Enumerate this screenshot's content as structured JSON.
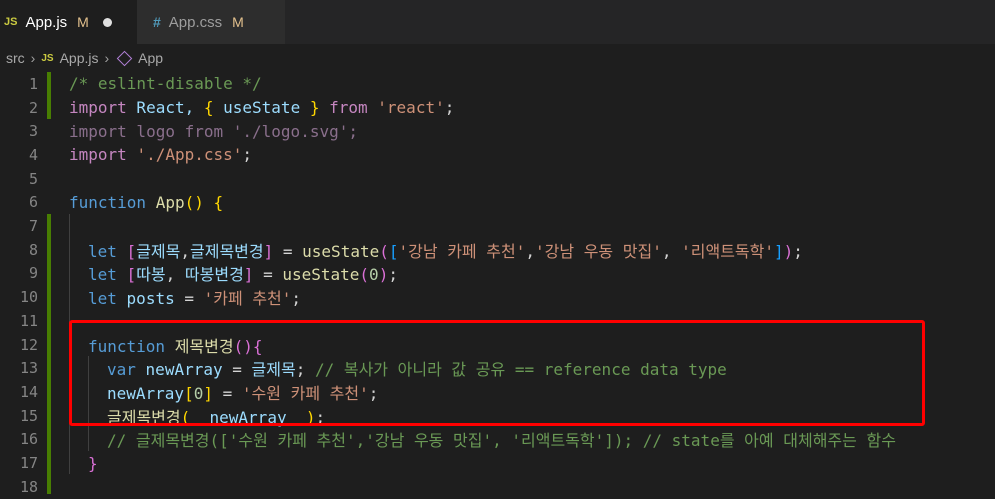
{
  "tabs": [
    {
      "badge": "JS",
      "name": "App.js",
      "status": "M"
    },
    {
      "badge": "#",
      "name": "App.css",
      "status": "M"
    }
  ],
  "breadcrumb": {
    "folder": "src",
    "file_badge": "JS",
    "file": "App.js",
    "symbol": "App"
  },
  "line_numbers": [
    "1",
    "2",
    "3",
    "4",
    "5",
    "6",
    "7",
    "8",
    "9",
    "10",
    "11",
    "12",
    "13",
    "14",
    "15",
    "16",
    "17",
    "18"
  ],
  "code": {
    "l1": "/* eslint-disable */",
    "l2": [
      "import",
      " React, ",
      "{",
      " useState ",
      "}",
      " ",
      "from",
      " ",
      "'react'",
      ";"
    ],
    "l3": [
      "import logo from './logo.svg';"
    ],
    "l4": [
      "import",
      " ",
      "'./App.css'",
      ";"
    ],
    "l6": [
      "function",
      " ",
      "App",
      "(",
      ")",
      " ",
      "{"
    ],
    "l8": [
      "let",
      " ",
      "[",
      "글제목",
      ",",
      "글제목변경",
      "]",
      " = ",
      "useState",
      "(",
      "[",
      "'강남 카페 추천'",
      ",",
      "'강남 우동 맛집'",
      ", ",
      "'리액트독학'",
      "]",
      ")",
      ";"
    ],
    "l9": [
      "let",
      " ",
      "[",
      "따봉",
      ", ",
      "따봉변경",
      "]",
      " = ",
      "useState",
      "(",
      "0",
      ")",
      ";"
    ],
    "l10": [
      "let",
      " ",
      "posts",
      " = ",
      "'카페 추천'",
      ";"
    ],
    "l12": [
      "function",
      " ",
      "제목변경",
      "(",
      ")",
      "{"
    ],
    "l13": [
      "var",
      " ",
      "newArray",
      " = ",
      "글제목",
      "; ",
      "// 복사가 아니라 값 공유 == reference data type"
    ],
    "l14": [
      "newArray",
      "[",
      "0",
      "]",
      " = ",
      "'수원 카페 추천'",
      ";"
    ],
    "l15": [
      "글제목변경",
      "(",
      "  newArray  ",
      ")",
      ";"
    ],
    "l16": "// 글제목변경(['수원 카페 추천','강남 우동 맛집', '리액트독학']); // state를 아예 대체해주는 함수",
    "l17": "}"
  }
}
